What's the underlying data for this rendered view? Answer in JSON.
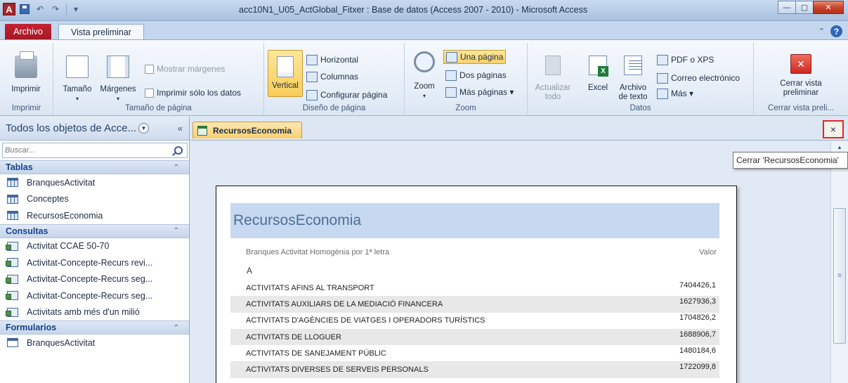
{
  "window": {
    "title": "acc10N1_U05_ActGlobal_Fitxer : Base de datos (Access 2007 - 2010)  -  Microsoft Access",
    "app_logo": "A",
    "controls": {
      "minimize": "—",
      "maximize": "▢",
      "close": "✕"
    }
  },
  "ribbon_tabs": {
    "file": "Archivo",
    "active": "Vista preliminar",
    "collapse_glyph": "⌃",
    "help_glyph": "?"
  },
  "ribbon": {
    "print_group": {
      "label": "Imprimir",
      "print": "Imprimir"
    },
    "page_size_group": {
      "label": "Tamaño de página",
      "size": "Tamaño",
      "margins": "Márgenes",
      "show_margins": "Mostrar márgenes",
      "print_data_only": "Imprimir sólo los datos"
    },
    "page_layout_group": {
      "label": "Diseño de página",
      "vertical": "Vertical",
      "horizontal": "Horizontal",
      "columns": "Columnas",
      "page_setup": "Configurar página"
    },
    "zoom_group": {
      "label": "Zoom",
      "zoom": "Zoom",
      "one_page": "Una página",
      "two_pages": "Dos páginas",
      "more_pages": "Más páginas ▾"
    },
    "data_group": {
      "label": "Datos",
      "refresh_all": "Actualizar todo",
      "excel": "Excel",
      "text_file": "Archivo de texto",
      "pdf": "PDF o XPS",
      "email": "Correo electrónico",
      "more": "Más ▾"
    },
    "close_group": {
      "label": "Cerrar vista preli...",
      "close_preview": "Cerrar vista preliminar"
    }
  },
  "nav": {
    "header": "Todos los objetos de Acce...",
    "search_placeholder": "Buscar...",
    "sections": [
      {
        "title": "Tablas",
        "items": [
          "BranquesActivitat",
          "Conceptes",
          "RecursosEconomia"
        ]
      },
      {
        "title": "Consultas",
        "items": [
          "Activitat CCAE 50-70",
          "Activitat-Concepte-Recurs revi...",
          "Activitat-Concepte-Recurs seg...",
          "Activitat-Concepte-Recurs seg...",
          "Activitats amb més d'un milió"
        ]
      },
      {
        "title": "Formularios",
        "items": [
          "BranquesActivitat"
        ]
      }
    ]
  },
  "document": {
    "tab_label": "RecursosEconomia",
    "close_glyph": "×",
    "tooltip": "Cerrar 'RecursosEconomia'"
  },
  "report": {
    "title": "RecursosEconomia",
    "column_group": "Branques Activitat Homogènia por 1ª letra",
    "column_value": "Valor",
    "group_letter": "A",
    "rows": [
      {
        "name": "ACTIVITATS AFINS AL TRANSPORT",
        "value": "7404426,1"
      },
      {
        "name": "ACTIVITATS AUXILIARS DE LA MEDIACIÓ FINANCERA",
        "value": "1627936,3"
      },
      {
        "name": "ACTIVITATS D'AGÈNCIES DE VIATGES I OPERADORS TURÍSTICS",
        "value": "1704826,2"
      },
      {
        "name": "ACTIVITATS DE LLOGUER",
        "value": "1688906,7"
      },
      {
        "name": "ACTIVITATS DE SANEJAMENT PÚBLIC",
        "value": "1480184,6"
      },
      {
        "name": "ACTIVITATS DIVERSES DE SERVEIS PERSONALS",
        "value": "1722099,8"
      }
    ]
  }
}
